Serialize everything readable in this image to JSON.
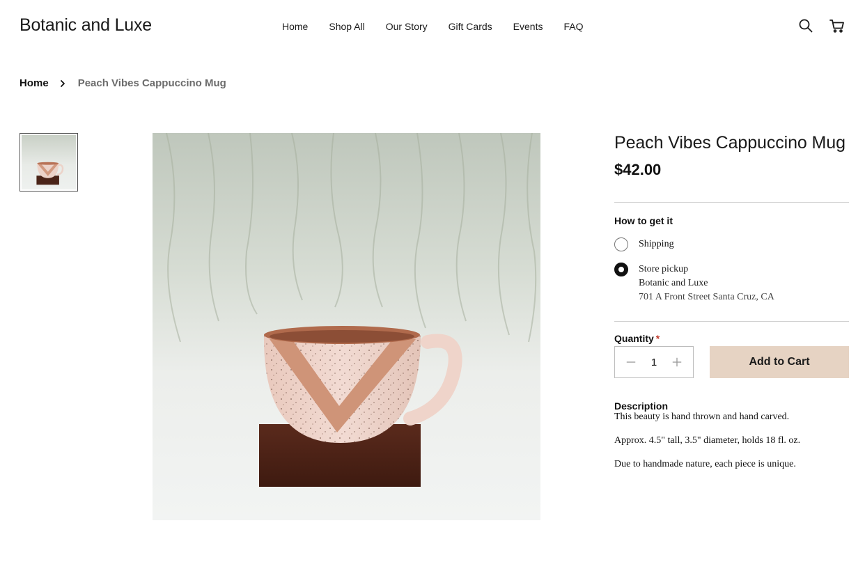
{
  "site": {
    "logo": "Botanic and Luxe"
  },
  "nav": {
    "items": [
      {
        "label": "Home"
      },
      {
        "label": "Shop All"
      },
      {
        "label": "Our Story"
      },
      {
        "label": "Gift Cards"
      },
      {
        "label": "Events"
      },
      {
        "label": "FAQ"
      }
    ]
  },
  "header_icons": {
    "search": "search-icon",
    "cart": "cart-icon"
  },
  "breadcrumb": {
    "home": "Home",
    "current": "Peach Vibes Cappuccino Mug"
  },
  "product": {
    "title": "Peach Vibes Cappuccino Mug",
    "price": "$42.00",
    "thumbnail_count": 1
  },
  "fulfillment": {
    "label": "How to get it",
    "options": [
      {
        "label": "Shipping",
        "selected": false
      },
      {
        "label": "Store pickup",
        "selected": true,
        "store_name": "Botanic and Luxe",
        "address": "701 A Front Street Santa Cruz, CA"
      }
    ]
  },
  "quantity": {
    "label": "Quantity",
    "required_mark": "*",
    "value": "1"
  },
  "cart": {
    "add_label": "Add to Cart",
    "button_color": "#e6d3c3"
  },
  "description": {
    "title": "Description",
    "paragraphs": [
      "This beauty is hand thrown and hand carved.",
      "Approx. 4.5\" tall, 3.5\" diameter, holds 18 fl. oz.",
      "Due to handmade nature, each piece is unique."
    ]
  }
}
